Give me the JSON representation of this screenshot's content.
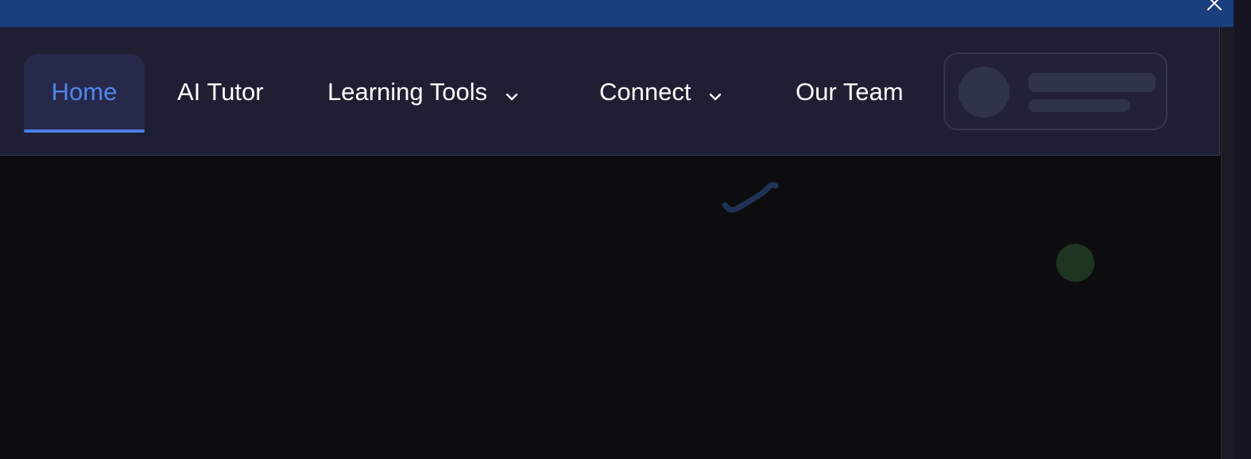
{
  "window": {
    "close_icon": "close-icon"
  },
  "nav": {
    "items": [
      {
        "label": "Home",
        "active": true
      },
      {
        "label": "AI Tutor"
      },
      {
        "label": "Learning Tools",
        "has_dropdown": true
      },
      {
        "label": "Connect",
        "has_dropdown": true
      },
      {
        "label": "Our Team"
      }
    ]
  },
  "colors": {
    "top_bar": "#1a3f7f",
    "nav_background": "#1f1f34",
    "active_accent": "#4a7fe6",
    "page_background": "#0d0d0f",
    "skeleton": "#2f3448",
    "decor_squiggle": "#1f3358",
    "decor_dot": "#1e3522"
  },
  "icons": {
    "dropdown": "chevron-down-icon",
    "close": "close-icon"
  }
}
